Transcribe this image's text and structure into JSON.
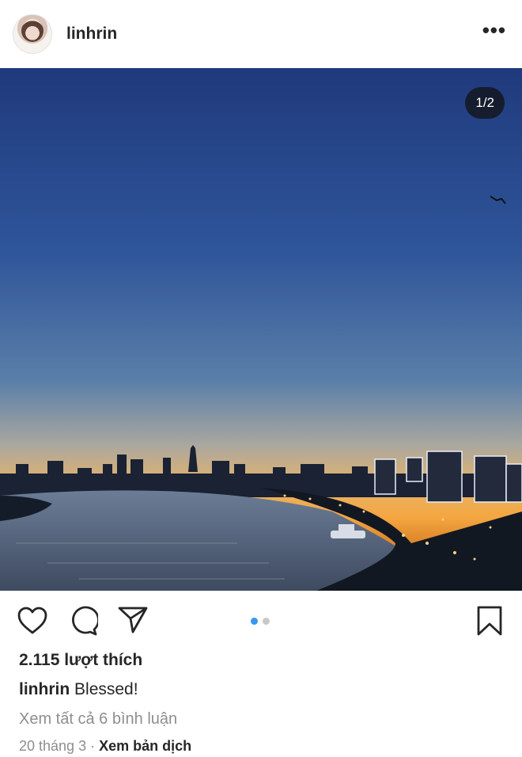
{
  "post": {
    "username": "linhrin",
    "more_icon": "more-horizontal-icon",
    "photo_counter": "1/2",
    "carousel": {
      "total": 2,
      "active_index": 0,
      "active_color": "#3897f0"
    },
    "likes_text": "2.115 lượt thích",
    "caption_user": "linhrin",
    "caption_text": "Blessed!",
    "view_comments": "Xem tất cả 6 bình luận",
    "date": "20 tháng 3",
    "separator": "·",
    "translate_label": "Xem bản dịch"
  },
  "actions": {
    "like_icon": "heart-icon",
    "comment_icon": "comment-icon",
    "share_icon": "send-icon",
    "save_icon": "bookmark-icon"
  }
}
